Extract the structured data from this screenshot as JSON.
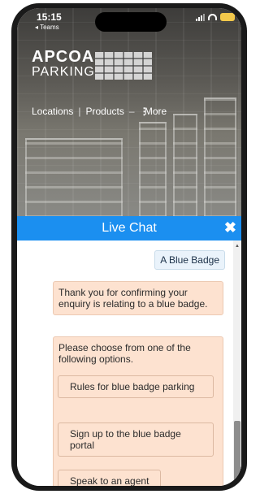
{
  "status_bar": {
    "time": "15:15",
    "back_app": "◂ Teams"
  },
  "site": {
    "logo_top": "APCOA",
    "logo_bottom": "PARKING"
  },
  "nav": {
    "items": [
      "Locations",
      "Products",
      "More"
    ]
  },
  "chat": {
    "title": "Live Chat",
    "close_glyph": "✖",
    "user_message": "A Blue Badge",
    "bot_messages": [
      "Thank you for confirming your enquiry is relating to a blue badge.",
      "Please choose from one of the following options."
    ],
    "options": [
      "Rules for blue badge parking",
      "Sign up to the blue badge portal",
      "Speak to an agent"
    ]
  },
  "colors": {
    "chat_header": "#1b8ff0",
    "bot_bubble": "#fde2d0",
    "user_bubble": "#eaf3fb",
    "battery": "#f2c84b"
  }
}
